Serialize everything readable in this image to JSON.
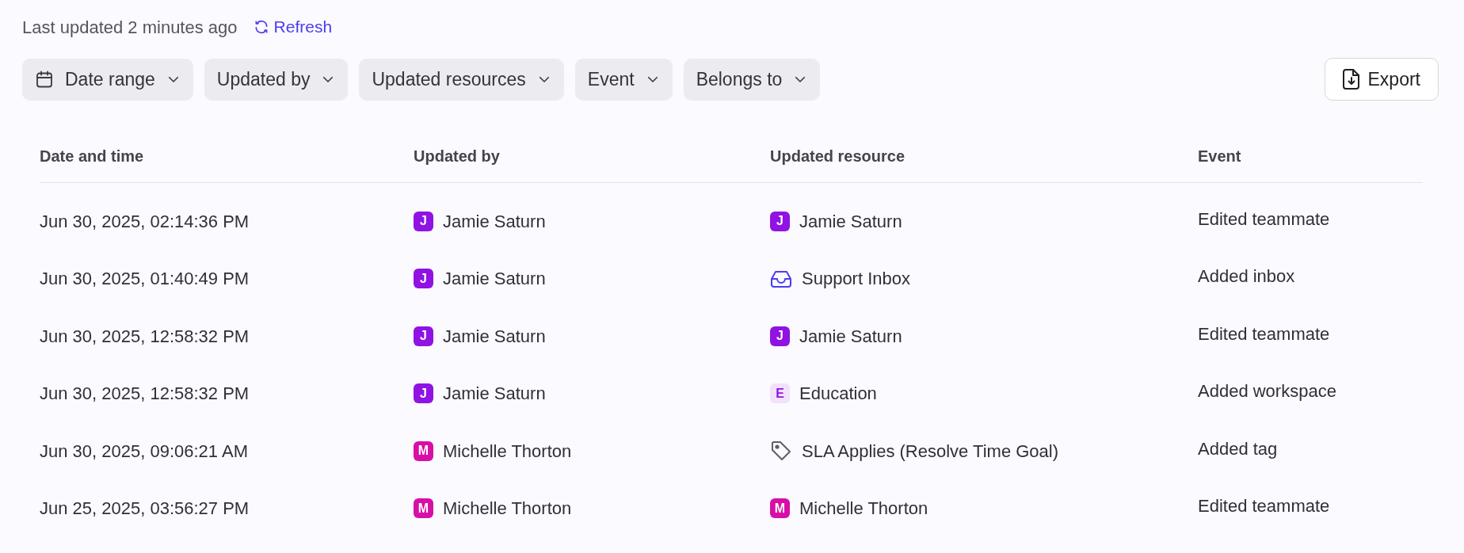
{
  "status": {
    "text": "Last updated 2 minutes ago",
    "refresh": "Refresh"
  },
  "filters": [
    {
      "label": "Date range",
      "kind": "date"
    },
    {
      "label": "Updated by",
      "kind": "plain"
    },
    {
      "label": "Updated resources",
      "kind": "plain"
    },
    {
      "label": "Event",
      "kind": "plain"
    },
    {
      "label": "Belongs to",
      "kind": "plain"
    }
  ],
  "export": "Export",
  "table": {
    "columns": [
      "Date and time",
      "Updated by",
      "Updated resource",
      "Event"
    ],
    "rows": [
      {
        "date": "Jun 30, 2025, 02:14:36 PM",
        "by": {
          "initial": "J",
          "name": "Jamie Saturn",
          "color": "#9013e3"
        },
        "resource": {
          "kind": "avatar",
          "initial": "J",
          "name": "Jamie Saturn",
          "color": "#9013e3"
        },
        "event": "Edited teammate"
      },
      {
        "date": "Jun 30, 2025, 01:40:49 PM",
        "by": {
          "initial": "J",
          "name": "Jamie Saturn",
          "color": "#9013e3"
        },
        "resource": {
          "kind": "inbox",
          "name": "Support Inbox"
        },
        "event": "Added inbox"
      },
      {
        "date": "Jun 30, 2025, 12:58:32 PM",
        "by": {
          "initial": "J",
          "name": "Jamie Saturn",
          "color": "#9013e3"
        },
        "resource": {
          "kind": "avatar",
          "initial": "J",
          "name": "Jamie Saturn",
          "color": "#9013e3"
        },
        "event": "Edited teammate"
      },
      {
        "date": "Jun 30, 2025, 12:58:32 PM",
        "by": {
          "initial": "J",
          "name": "Jamie Saturn",
          "color": "#9013e3"
        },
        "resource": {
          "kind": "workspace",
          "initial": "E",
          "name": "Education"
        },
        "event": "Added workspace"
      },
      {
        "date": "Jun 30, 2025, 09:06:21 AM",
        "by": {
          "initial": "M",
          "name": "Michelle Thorton",
          "color": "#d80fa6"
        },
        "resource": {
          "kind": "tag",
          "name": "SLA Applies (Resolve Time Goal)"
        },
        "event": "Added tag"
      },
      {
        "date": "Jun 25, 2025, 03:56:27 PM",
        "by": {
          "initial": "M",
          "name": "Michelle Thorton",
          "color": "#d80fa6"
        },
        "resource": {
          "kind": "avatar",
          "initial": "M",
          "name": "Michelle Thorton",
          "color": "#d80fa6"
        },
        "event": "Edited teammate"
      }
    ]
  }
}
